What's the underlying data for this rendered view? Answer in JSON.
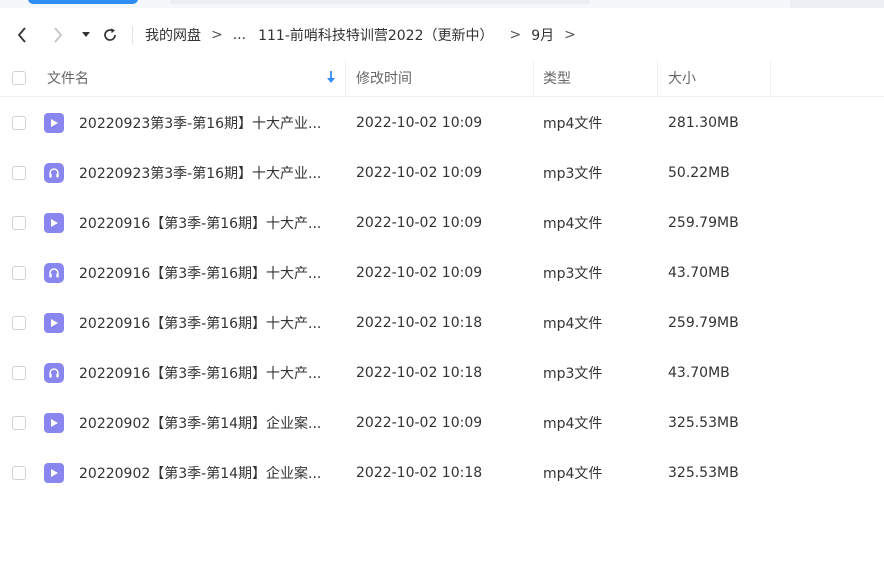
{
  "nav": {
    "back_icon": "chevron-left-icon",
    "forward_icon": "chevron-right-icon",
    "history_icon": "caret-down-icon",
    "refresh_icon": "refresh-icon"
  },
  "breadcrumb": {
    "items": [
      "我的网盘",
      "...",
      "111-前哨科技特训营2022（更新中）",
      "9月"
    ],
    "separator": ">"
  },
  "table": {
    "columns": {
      "name": "文件名",
      "modified": "修改时间",
      "type": "类型",
      "size": "大小"
    },
    "sort_icon": "sort-down-arrow-icon",
    "rows": [
      {
        "name": "20220923第3季-第16期】十大产业...",
        "modified": "2022-10-02 10:09",
        "type": "mp4文件",
        "size": "281.30MB",
        "icon": "video-file-icon"
      },
      {
        "name": "20220923第3季-第16期】十大产业...",
        "modified": "2022-10-02 10:09",
        "type": "mp3文件",
        "size": "50.22MB",
        "icon": "audio-file-icon"
      },
      {
        "name": "20220916【第3季-第16期】十大产...",
        "modified": "2022-10-02 10:09",
        "type": "mp4文件",
        "size": "259.79MB",
        "icon": "video-file-icon"
      },
      {
        "name": "20220916【第3季-第16期】十大产...",
        "modified": "2022-10-02 10:09",
        "type": "mp3文件",
        "size": "43.70MB",
        "icon": "audio-file-icon"
      },
      {
        "name": "20220916【第3季-第16期】十大产...",
        "modified": "2022-10-02 10:18",
        "type": "mp4文件",
        "size": "259.79MB",
        "icon": "video-file-icon"
      },
      {
        "name": "20220916【第3季-第16期】十大产...",
        "modified": "2022-10-02 10:18",
        "type": "mp3文件",
        "size": "43.70MB",
        "icon": "audio-file-icon"
      },
      {
        "name": "20220902【第3季-第14期】企业案...",
        "modified": "2022-10-02 10:09",
        "type": "mp4文件",
        "size": "325.53MB",
        "icon": "video-file-icon"
      },
      {
        "name": "20220902【第3季-第14期】企业案...",
        "modified": "2022-10-02 10:18",
        "type": "mp4文件",
        "size": "325.53MB",
        "icon": "video-file-icon"
      }
    ]
  },
  "colors": {
    "accent": "#2f8df5",
    "file_icon": "#8a86f0"
  }
}
